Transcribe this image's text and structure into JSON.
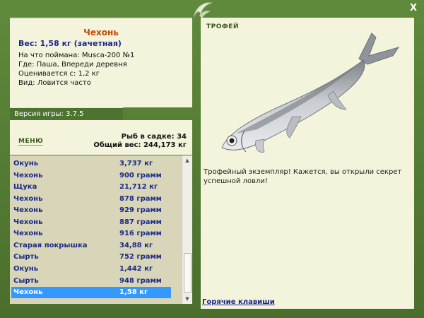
{
  "window": {
    "close_label": "X"
  },
  "catch": {
    "title": "Чехонь",
    "weight": "Вес: 1,58 кг (зачетная)",
    "bait": "На что поймана: Musca-200 №1",
    "place": "Где: Паша, Впереди деревня",
    "value": "Оценивается с: 1,2 кг",
    "kind": "Вид: Ловится часто"
  },
  "version": "Версия игры: 3.7.5",
  "menu_label": "МЕНЮ",
  "stats": {
    "count": "Рыб в садке: 34",
    "total": "Общий вес: 244,173 кг"
  },
  "fish_list": [
    {
      "name": "Окунь",
      "weight": "3,737 кг"
    },
    {
      "name": "Чехонь",
      "weight": "900 грамм"
    },
    {
      "name": "Щука",
      "weight": "21,712 кг"
    },
    {
      "name": "Чехонь",
      "weight": "878 грамм"
    },
    {
      "name": "Чехонь",
      "weight": "929 грамм"
    },
    {
      "name": "Чехонь",
      "weight": "887 грамм"
    },
    {
      "name": "Чехонь",
      "weight": "916 грамм"
    },
    {
      "name": "Старая покрышка",
      "weight": "34,88 кг"
    },
    {
      "name": "Сырть",
      "weight": "752 грамм"
    },
    {
      "name": "Окунь",
      "weight": "1,442 кг"
    },
    {
      "name": "Сырть",
      "weight": "948 грамм"
    },
    {
      "name": "Чехонь",
      "weight": "1,58 кг"
    }
  ],
  "selected_index": 11,
  "trophy": {
    "label": "ТРОФЕЙ",
    "text": "Трофейный экземпляр! Кажется, вы открыли секрет успешной ловли!",
    "hotkeys": "Горячие клавиши"
  },
  "colors": {
    "frame": "#4e7330",
    "panel": "#f4f3dc",
    "title": "#c04a00",
    "link": "#1a2a8a",
    "selected": "#3399ff"
  }
}
